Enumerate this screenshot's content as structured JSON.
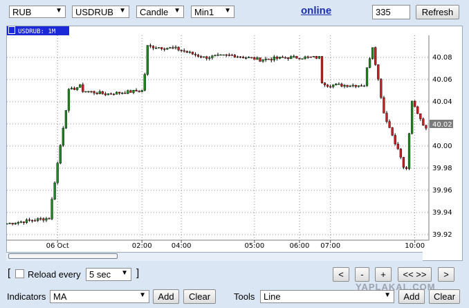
{
  "toolbar": {
    "currency": "RUB",
    "symbol": "USDRUB",
    "chart_type": "Candle",
    "timeframe": "Min1",
    "status_link": "online",
    "bars_value": "335",
    "refresh_label": "Refresh"
  },
  "chart": {
    "tag": "USDRUB: 1M",
    "current_price_label": "40.02"
  },
  "chart_data": {
    "type": "candlestick",
    "yticks": [
      "40.08",
      "40.06",
      "40.04",
      "40.02",
      "40.00",
      "39.98",
      "39.96",
      "39.94",
      "39.92"
    ],
    "ylim": [
      39.915,
      40.1
    ],
    "xticks": [
      {
        "label": "06 Oct",
        "i": 18
      },
      {
        "label": "02:00",
        "i": 48
      },
      {
        "label": "04:00",
        "i": 62
      },
      {
        "label": "05:00",
        "i": 88
      },
      {
        "label": "06:00",
        "i": 104
      },
      {
        "label": "07:00",
        "i": 115
      },
      {
        "label": "10:00",
        "i": 145
      }
    ],
    "current_price": 40.02,
    "segments": [
      {
        "start": 0,
        "end": 15,
        "from": 39.93,
        "to": 39.935
      },
      {
        "start": 15,
        "end": 22,
        "from": 39.935,
        "to": 40.05
      },
      {
        "start": 22,
        "end": 27,
        "from": 40.05,
        "to": 40.055
      },
      {
        "start": 27,
        "end": 35,
        "from": 40.05,
        "to": 40.047
      },
      {
        "start": 35,
        "end": 48,
        "from": 40.047,
        "to": 40.05
      },
      {
        "start": 48,
        "end": 50,
        "from": 40.05,
        "to": 40.08
      },
      {
        "start": 50,
        "end": 60,
        "from": 40.09,
        "to": 40.088
      },
      {
        "start": 60,
        "end": 70,
        "from": 40.088,
        "to": 40.08
      },
      {
        "start": 70,
        "end": 80,
        "from": 40.08,
        "to": 40.082
      },
      {
        "start": 80,
        "end": 90,
        "from": 40.082,
        "to": 40.078
      },
      {
        "start": 90,
        "end": 100,
        "from": 40.078,
        "to": 40.08
      },
      {
        "start": 100,
        "end": 112,
        "from": 40.08,
        "to": 40.08
      },
      {
        "start": 112,
        "end": 114,
        "from": 40.058,
        "to": 40.055
      },
      {
        "start": 114,
        "end": 128,
        "from": 40.055,
        "to": 40.055
      },
      {
        "start": 128,
        "end": 130,
        "from": 40.07,
        "to": 40.09
      },
      {
        "start": 130,
        "end": 134,
        "from": 40.09,
        "to": 40.03
      },
      {
        "start": 134,
        "end": 140,
        "from": 40.03,
        "to": 39.99
      },
      {
        "start": 140,
        "end": 142,
        "from": 39.99,
        "to": 39.97
      },
      {
        "start": 142,
        "end": 144,
        "from": 39.98,
        "to": 40.04
      },
      {
        "start": 144,
        "end": 150,
        "from": 40.04,
        "to": 40.01
      }
    ]
  },
  "bottom": {
    "bracket_open": "[",
    "bracket_close": "]",
    "reload_label": "Reload every",
    "reload_value": "5 sec",
    "nav": [
      "<",
      "-",
      "+",
      "<< >>",
      ">"
    ],
    "indicators_label": "Indicators",
    "indicator_value": "MA",
    "add_label": "Add",
    "clear_label": "Clear",
    "tools_label": "Tools",
    "tool_value": "Line",
    "watermark": "YAPLAKAL.COM"
  }
}
